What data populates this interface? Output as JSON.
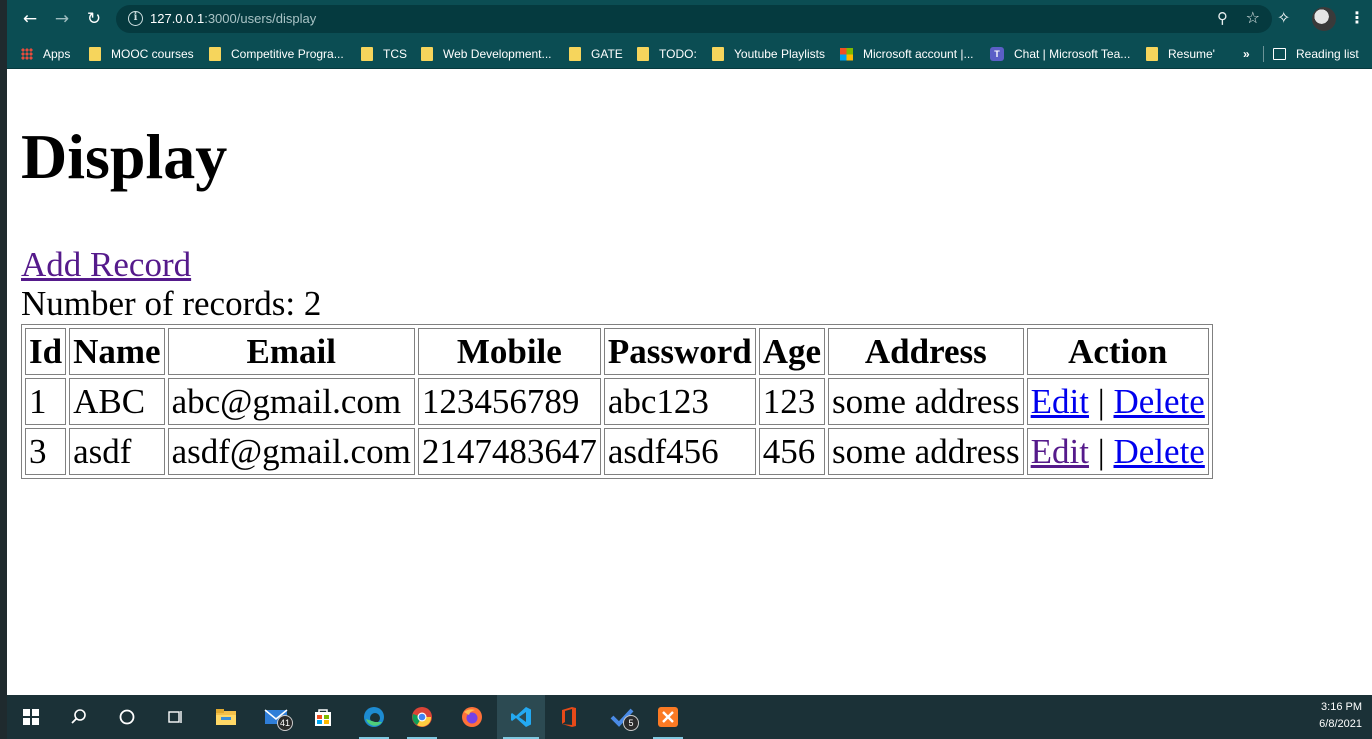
{
  "browser": {
    "url_host": "127.0.0.1",
    "url_path": ":3000/users/display",
    "icons": {
      "back": "back-arrow-icon",
      "forward": "forward-arrow-icon",
      "reload": "reload-icon",
      "site_info": "info-icon",
      "zoom": "zoom-icon",
      "bookmark": "star-icon",
      "extensions": "puzzle-icon",
      "menu": "kebab-menu-icon"
    }
  },
  "bookmarks": {
    "apps": "Apps",
    "items": [
      "MOOC courses",
      "Competitive Progra...",
      "TCS",
      "Web Development...",
      "GATE",
      "TODO:",
      "Youtube Playlists",
      "Microsoft account |...",
      "Chat | Microsoft Tea...",
      "Resume'"
    ],
    "overflow": "»",
    "reading_list": "Reading list"
  },
  "page": {
    "title": "Display",
    "add_record": "Add Record",
    "record_count": "Number of records: 2",
    "table": {
      "headers": [
        "Id",
        "Name",
        "Email",
        "Mobile",
        "Password",
        "Age",
        "Address",
        "Action"
      ],
      "rows": [
        {
          "id": "1",
          "name": "ABC",
          "email": "abc@gmail.com",
          "mobile": "123456789",
          "password": "abc123",
          "age": "123",
          "address": "some address",
          "edit": "Edit",
          "sep": "|",
          "delete": "Delete"
        },
        {
          "id": "3",
          "name": "asdf",
          "email": "asdf@gmail.com",
          "mobile": "2147483647",
          "password": "asdf456",
          "age": "456",
          "address": "some address",
          "edit": "Edit",
          "sep": "|",
          "delete": "Delete"
        }
      ]
    },
    "colors": {
      "link": "#0000ee",
      "visited_link": "#551a8b"
    }
  },
  "taskbar": {
    "mail_badge": "41",
    "todo_badge": "5",
    "time": "3:16 PM",
    "date": "6/8/2021"
  },
  "theme": {
    "chrome_bar": "#0b4d53",
    "taskbar": "#1b3137"
  }
}
